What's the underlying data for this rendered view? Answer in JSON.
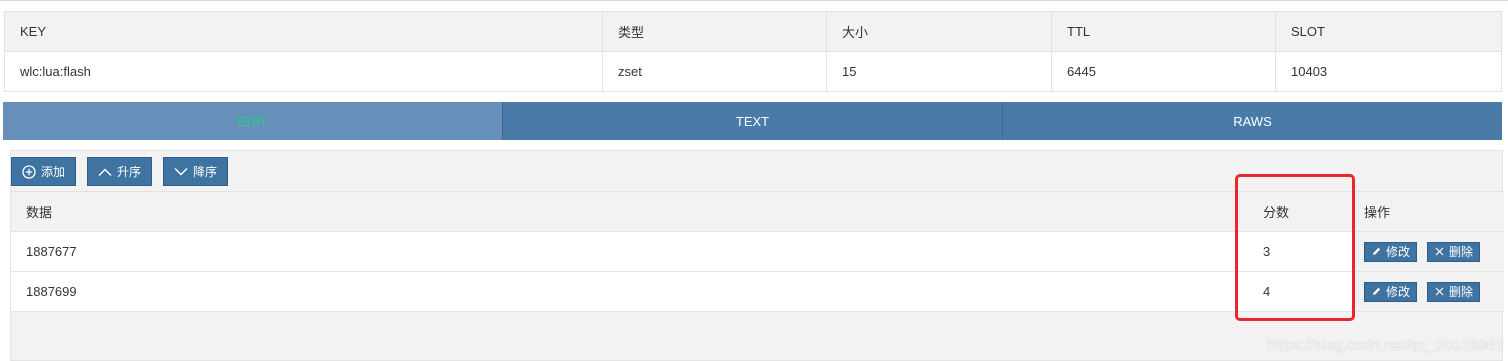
{
  "info": {
    "headers": [
      "KEY",
      "类型",
      "大小",
      "TTL",
      "SLOT"
    ],
    "row": [
      "wlc:lua:flash",
      "zset",
      "15",
      "6445",
      "10403"
    ]
  },
  "tabs": [
    {
      "label": "EDIT"
    },
    {
      "label": "TEXT"
    },
    {
      "label": "RAWS"
    }
  ],
  "toolbar": {
    "add_label": "添加",
    "asc_label": "升序",
    "desc_label": "降序"
  },
  "table": {
    "headers": {
      "data": "数据",
      "score": "分数",
      "ops": "操作"
    },
    "rows": [
      {
        "data": "1887677",
        "score": "3"
      },
      {
        "data": "1887699",
        "score": "4"
      }
    ],
    "edit_label": "修改",
    "delete_label": "删除"
  },
  "colors": {
    "tab_bg": "#4a7aa8",
    "tab_active_bg": "#6690ba",
    "tab_active_text": "#1fd37e",
    "button_bg": "#3f73a2",
    "highlight": "#e8262d"
  },
  "watermark": "https://blog.csdn.net/qq_20128967"
}
